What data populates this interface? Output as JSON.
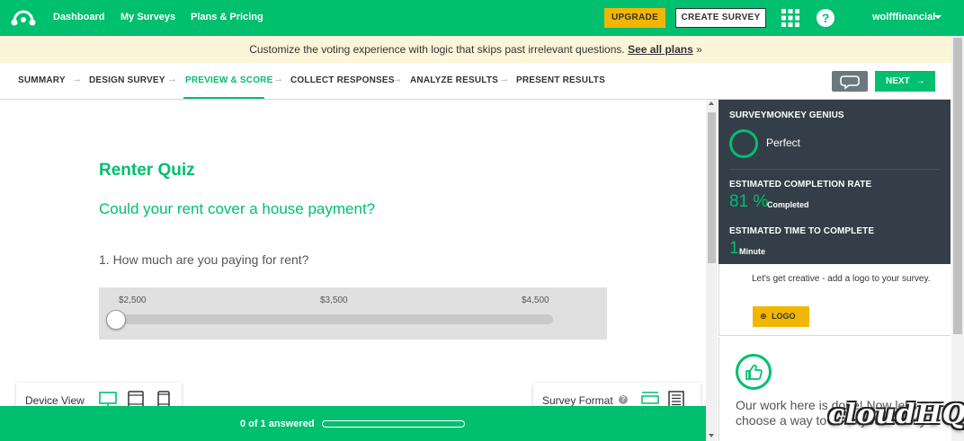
{
  "topbar": {
    "nav": [
      "Dashboard",
      "My Surveys",
      "Plans & Pricing"
    ],
    "upgrade_label": "UPGRADE",
    "create_label": "CREATE SURVEY",
    "help_glyph": "?",
    "user": "wolfffinancial",
    "accent": "#00bf6f",
    "upgrade_color": "#f2b600"
  },
  "promo": {
    "text": "Customize the voting experience with logic that skips past irrelevant questions.",
    "link": "See all plans",
    "suffix": "»"
  },
  "steps": {
    "items": [
      "SUMMARY",
      "DESIGN SURVEY",
      "PREVIEW & SCORE",
      "COLLECT RESPONSES",
      "ANALYZE RESULTS",
      "PRESENT RESULTS"
    ],
    "active": "PREVIEW & SCORE",
    "arrow": "→",
    "next_label": "NEXT",
    "next_arrow": "→"
  },
  "survey": {
    "title": "Renter Quiz",
    "subtitle": "Could your rent cover a house payment?",
    "question": "1. How much are you paying for rent?",
    "slider_labels": [
      "$2,500",
      "$3,500",
      "$4,500"
    ],
    "slider_value_fraction": 0
  },
  "device_view": {
    "label": "Device View"
  },
  "survey_format": {
    "label": "Survey Format",
    "help_glyph": "?"
  },
  "progress": {
    "text": "0 of 1 answered",
    "fraction": 0
  },
  "genius": {
    "heading": "SURVEYMONKEY GENIUS",
    "rating": "Perfect",
    "completion_heading": "ESTIMATED COMPLETION RATE",
    "completion_value": "81 %",
    "completion_unit": "Completed",
    "time_heading": "ESTIMATED TIME TO COMPLETE",
    "time_value": "1",
    "time_unit": "Minute"
  },
  "logo_panel": {
    "text": "Let's get creative - add a logo to your survey.",
    "button_label": "LOGO",
    "button_icon": "⊕"
  },
  "done_panel": {
    "text": "Our work here is done! Now let's choose a way to send your survey."
  },
  "watermark": "cloudHQ"
}
